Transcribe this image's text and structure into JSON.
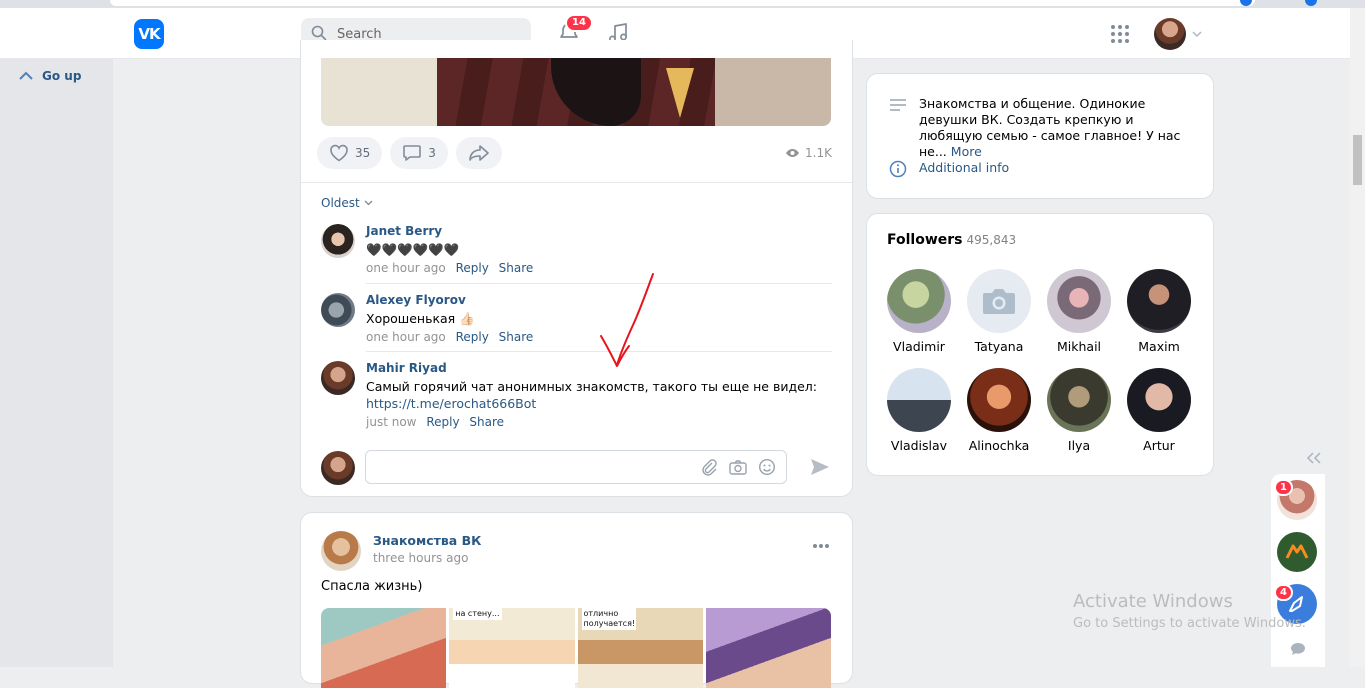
{
  "header": {
    "logo_text": "VK",
    "search_placeholder": "Search",
    "notifications_count": "14"
  },
  "sidebar": {
    "go_up_label": "Go up"
  },
  "post1": {
    "likes": "35",
    "comments": "3",
    "views": "1.1K",
    "sort_label": "Oldest",
    "comments_list": [
      {
        "name": "Janet Berry",
        "text": "🖤🖤🖤🖤🖤🖤",
        "time": "one hour ago",
        "reply": "Reply",
        "share": "Share"
      },
      {
        "name": "Alexey Flyorov",
        "text": "Хорошенькая 👍🏻",
        "time": "one hour ago",
        "reply": "Reply",
        "share": "Share"
      },
      {
        "name": "Mahir Riyad",
        "text": "Самый горячий чат анонимных знакомств, такого ты еще не видел:",
        "link": "https://t.me/erochat666Bot",
        "time": "just now",
        "reply": "Reply",
        "share": "Share"
      }
    ]
  },
  "post2": {
    "author": "Знакомства ВК",
    "time": "three hours ago",
    "text": "Спасла жизнь)",
    "comic_captions": [
      "на стену...",
      "отлично получается!"
    ]
  },
  "info": {
    "description": "Знакомства и общение. Одинокие девушки ВК. Создать крепкую и любящую семью - самое главное! У нас не...",
    "more_label": "More",
    "additional_info_label": "Additional info"
  },
  "followers": {
    "title": "Followers",
    "count": "495,843",
    "people": [
      "Vladimir",
      "Tatyana",
      "Mikhail",
      "Maxim",
      "Vladislav",
      "Alinochka",
      "Ilya",
      "Artur"
    ]
  },
  "dock": {
    "badges": [
      "1",
      "4"
    ]
  },
  "watermark": {
    "line1": "Activate Windows",
    "line2": "Go to Settings to activate Windows."
  },
  "colors": {
    "brand": "#0077ff",
    "link": "#2a5885",
    "badge": "#ff3347",
    "annotation": "#e8141b"
  }
}
